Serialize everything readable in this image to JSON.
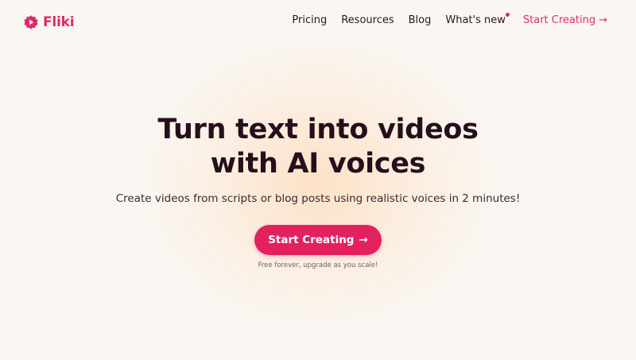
{
  "brand": {
    "name": "Fliki",
    "color": "#e0286a"
  },
  "nav": {
    "links": [
      {
        "label": "Pricing"
      },
      {
        "label": "Resources"
      },
      {
        "label": "Blog"
      },
      {
        "label": "What's new",
        "has_badge": true
      }
    ],
    "cta_label": "Start Creating",
    "cta_arrow": "→"
  },
  "hero": {
    "headline_line1": "Turn text into videos",
    "headline_line2": "with AI voices",
    "subheadline": "Create videos from scripts or blog posts using realistic voices in 2 minutes!",
    "cta_label": "Start Creating",
    "cta_arrow": "→",
    "note": "Free forever, upgrade as you scale!"
  },
  "colors": {
    "accent": "#e3215f",
    "background": "#faf7f3",
    "text": "#260f1c"
  },
  "icons": {
    "logo": "play-badge-icon",
    "nav_arrow": "arrow-right-icon",
    "notification": "notification-dot-icon"
  }
}
